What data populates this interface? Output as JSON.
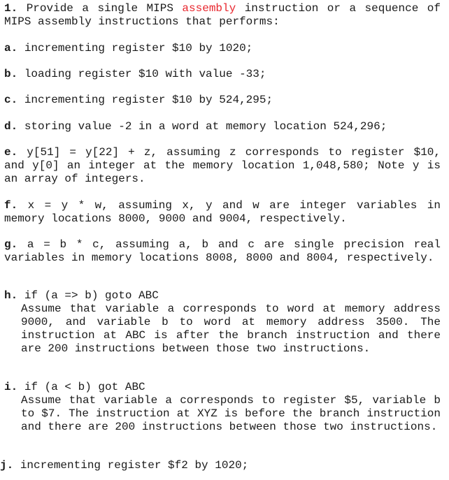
{
  "question": {
    "number": "1.",
    "intro_before": "Provide a single MIPS ",
    "intro_highlight": "assembly",
    "intro_after": " instruction or a sequence of MIPS assembly instructions that performs:",
    "highlight_color": "#e8262e"
  },
  "items": [
    {
      "label": "a.",
      "text": "incrementing register $10 by 1020;"
    },
    {
      "label": "b.",
      "text": "loading register $10 with value -33;"
    },
    {
      "label": "c.",
      "text": "incrementing register $10 by 524,295;"
    },
    {
      "label": "d.",
      "text": "storing value -2 in a word at memory location 524,296;"
    },
    {
      "label": "e.",
      "text": "y[51] = y[22] + z, assuming z corresponds to register $10, and y[0] an integer at the memory location 1,048,580; Note y is an array of integers."
    },
    {
      "label": "f.",
      "text": "x = y * w, assuming x, y and w are integer variables in memory locations 8000, 9000 and 9004, respectively."
    },
    {
      "label": "g.",
      "text": "a = b * c, assuming a, b and c are single precision real variables in memory locations 8008, 8000 and 8004, respectively."
    },
    {
      "label": "h.",
      "text": "if (a => b) goto ABC",
      "detail": "Assume that variable a corresponds to word at memory address 9000, and variable b to word at memory address 3500. The instruction at ABC is after the branch instruction and there are 200 instructions between those two instructions."
    },
    {
      "label": "i.",
      "text": "if (a < b) got ABC",
      "detail": "Assume that variable a corresponds to register $5, variable b to $7. The instruction at XYZ is before the branch instruction and there are 200 instructions between those two instructions."
    },
    {
      "label": "j.",
      "text": "incrementing register $f2 by 1020;"
    }
  ]
}
